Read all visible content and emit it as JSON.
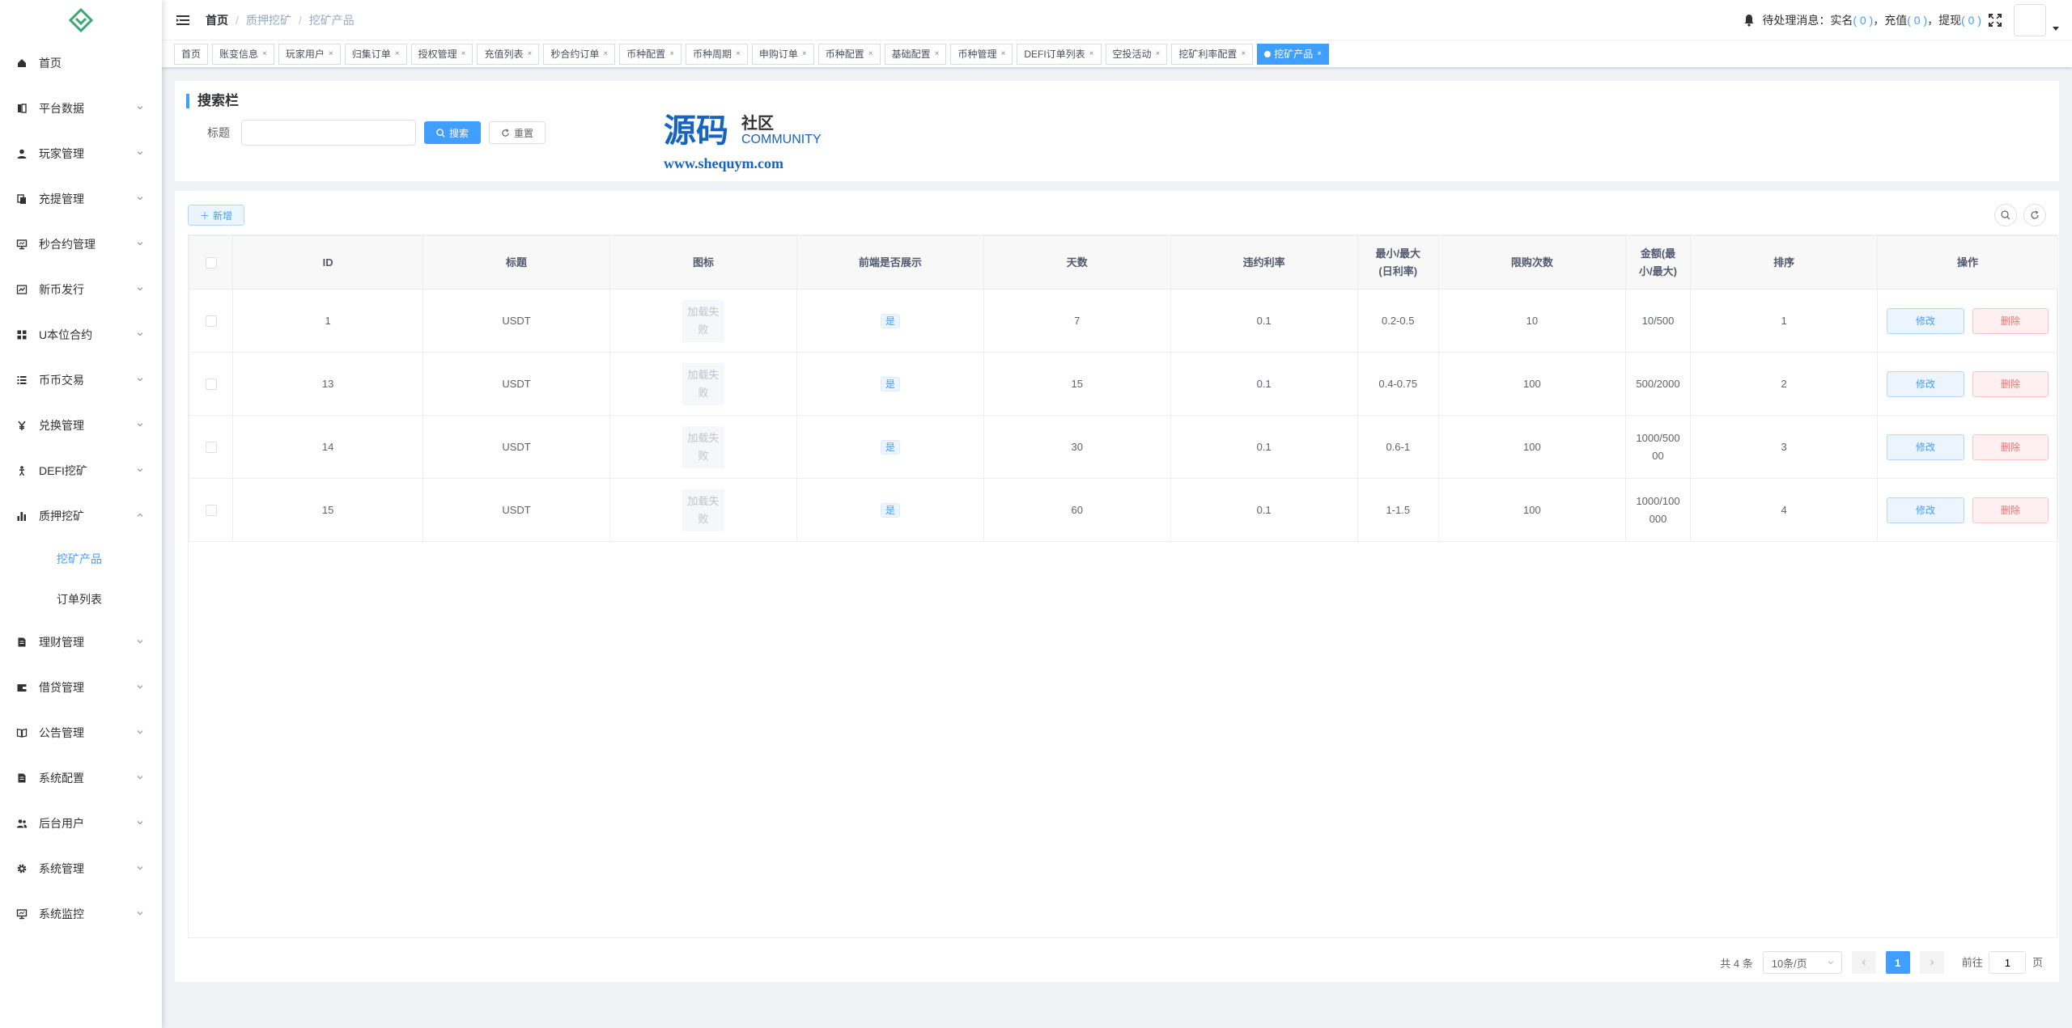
{
  "sidebar": {
    "items": [
      {
        "label": "首页",
        "icon": "home-icon"
      },
      {
        "label": "平台数据",
        "icon": "book-icon"
      },
      {
        "label": "玩家管理",
        "icon": "user-icon"
      },
      {
        "label": "充提管理",
        "icon": "documents-icon"
      },
      {
        "label": "秒合约管理",
        "icon": "monitor-icon"
      },
      {
        "label": "新币发行",
        "icon": "chart-icon"
      },
      {
        "label": "U本位合约",
        "icon": "grid-icon"
      },
      {
        "label": "币币交易",
        "icon": "list-icon"
      },
      {
        "label": "兑换管理",
        "icon": "yen-icon"
      },
      {
        "label": "DEFI挖矿",
        "icon": "person-icon"
      },
      {
        "label": "质押挖矿",
        "icon": "bar-chart-icon"
      },
      {
        "label": "理财管理",
        "icon": "file-icon"
      },
      {
        "label": "借贷管理",
        "icon": "wallet-icon"
      },
      {
        "label": "公告管理",
        "icon": "open-book-icon"
      },
      {
        "label": "系统配置",
        "icon": "file-icon"
      },
      {
        "label": "后台用户",
        "icon": "users-icon"
      },
      {
        "label": "系统管理",
        "icon": "gear-icon"
      },
      {
        "label": "系统监控",
        "icon": "monitor-icon"
      }
    ],
    "subitems": [
      {
        "label": "挖矿产品"
      },
      {
        "label": "订单列表"
      }
    ]
  },
  "navbar": {
    "breadcrumb": [
      "首页",
      "质押挖矿",
      "挖矿产品"
    ],
    "notice_prefix": "待处理消息：实名",
    "count_realname": "( 0 )",
    "notice_recharge": "，充值",
    "count_recharge": "( 0 )",
    "notice_withdraw": "，提现",
    "count_withdraw": "( 0 )"
  },
  "tags": [
    {
      "label": "首页"
    },
    {
      "label": "账变信息"
    },
    {
      "label": "玩家用户"
    },
    {
      "label": "归集订单"
    },
    {
      "label": "授权管理"
    },
    {
      "label": "充值列表"
    },
    {
      "label": "秒合约订单"
    },
    {
      "label": "币种配置"
    },
    {
      "label": "币种周期"
    },
    {
      "label": "申购订单"
    },
    {
      "label": "币种配置"
    },
    {
      "label": "基础配置"
    },
    {
      "label": "币种管理"
    },
    {
      "label": "DEFI订单列表"
    },
    {
      "label": "空投活动"
    },
    {
      "label": "挖矿利率配置"
    },
    {
      "label": "挖矿产品"
    }
  ],
  "search": {
    "title": "搜索栏",
    "field_label": "标题",
    "field_value": "",
    "search_label": "搜索",
    "reset_label": "重置"
  },
  "watermark": {
    "big": "源码",
    "small": "社区",
    "community": "COMMUNITY",
    "url": "www.shequym.com"
  },
  "toolbar": {
    "add_label": "新增"
  },
  "table": {
    "columns": [
      "ID",
      "标题",
      "图标",
      "前端是否展示",
      "天数",
      "违约利率",
      "最小/最大\n(日利率)",
      "限购次数",
      "金额(最\n小/最大)",
      "排序",
      "操作"
    ],
    "col_min_max": [
      "最小/最大",
      "(日利率)"
    ],
    "col_amount": [
      "金额(最",
      "小/最大)"
    ],
    "img_fail": [
      "加载失",
      "败"
    ],
    "rows": [
      {
        "id": "1",
        "title": "USDT",
        "show": "是",
        "days": "7",
        "penalty": "0.1",
        "rate": "0.2-0.5",
        "limit": "10",
        "amount": [
          "10/500"
        ],
        "sort": "1"
      },
      {
        "id": "13",
        "title": "USDT",
        "show": "是",
        "days": "15",
        "penalty": "0.1",
        "rate": "0.4-0.75",
        "limit": "100",
        "amount": [
          "500/2000"
        ],
        "sort": "2"
      },
      {
        "id": "14",
        "title": "USDT",
        "show": "是",
        "days": "30",
        "penalty": "0.1",
        "rate": "0.6-1",
        "limit": "100",
        "amount": [
          "1000/500",
          "00"
        ],
        "sort": "3"
      },
      {
        "id": "15",
        "title": "USDT",
        "show": "是",
        "days": "60",
        "penalty": "0.1",
        "rate": "1-1.5",
        "limit": "100",
        "amount": [
          "1000/100",
          "000"
        ],
        "sort": "4"
      }
    ],
    "edit_label": "修改",
    "delete_label": "删除"
  },
  "pagination": {
    "total": "共 4 条",
    "page_size": "10条/页",
    "current_page": "1",
    "goto_prefix": "前往",
    "goto_value": "1",
    "goto_suffix": "页"
  },
  "colors": {
    "primary": "#409eff",
    "danger": "#f56c6c",
    "logo": "#3aa876"
  }
}
